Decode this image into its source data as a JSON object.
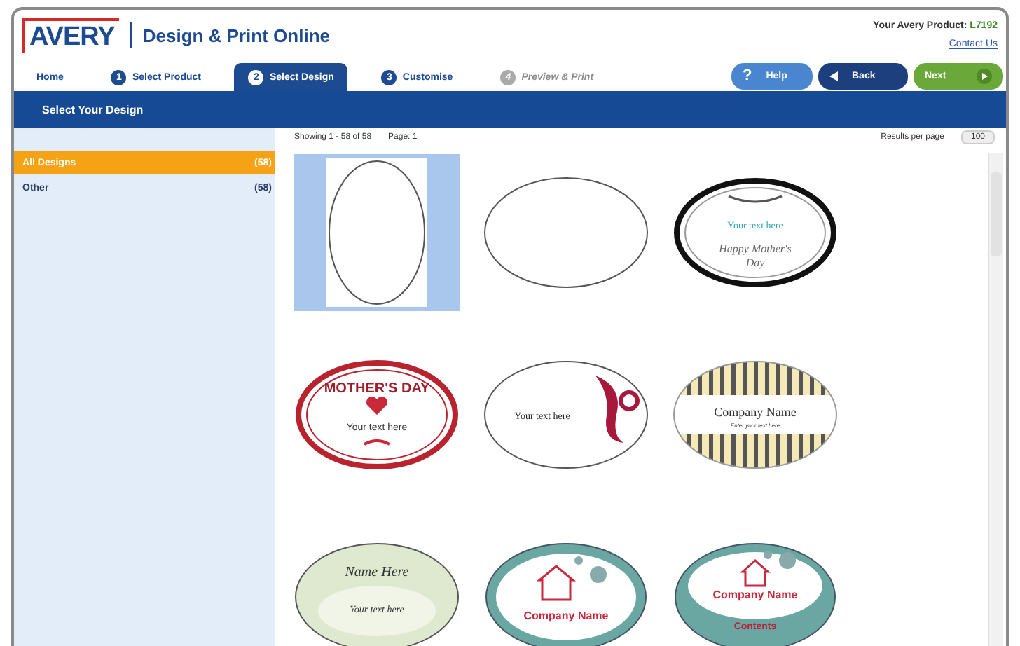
{
  "header": {
    "logo": "AVERY",
    "title": "Design & Print Online",
    "product_label": "Your Avery Product:",
    "product_code": "L7192",
    "contact_link": "Contact Us"
  },
  "steps": [
    {
      "label": "Home",
      "selected": false,
      "disabled": false
    },
    {
      "number": "1",
      "label": "Select Product",
      "selected": false,
      "disabled": false
    },
    {
      "number": "2",
      "label": "Select Design",
      "selected": true,
      "disabled": false
    },
    {
      "number": "3",
      "label": "Customise",
      "selected": false,
      "disabled": false
    },
    {
      "number": "4",
      "label": "Preview & Print",
      "selected": false,
      "disabled": true
    }
  ],
  "nav_buttons": [
    {
      "kind": "help",
      "icon": "?",
      "label": "Help"
    },
    {
      "kind": "back",
      "label": "Back"
    },
    {
      "kind": "next",
      "label": "Next"
    }
  ],
  "page_title": "Select Your Design",
  "sidebar": {
    "items": [
      {
        "label": "All Designs",
        "count": "(58)",
        "selected": true
      },
      {
        "label": "Other",
        "count": "(58)",
        "selected": false
      }
    ]
  },
  "results": {
    "showing": "Showing 1 - 58 of 58",
    "page": "Page:  1",
    "per_page_label": "Results per page",
    "per_page": "100"
  },
  "designs": [
    {
      "kind": "blank-portrait",
      "selected": true
    },
    {
      "kind": "blank",
      "selected": false
    },
    {
      "kind": "frame",
      "selected": false,
      "texts": [
        "Your text here",
        "Happy Mother's",
        "Day"
      ]
    },
    {
      "kind": "stamp",
      "selected": false,
      "texts": [
        "MOTHER'S DAY",
        "Your text here"
      ]
    },
    {
      "kind": "floral",
      "selected": false,
      "texts": [
        "Your text here"
      ]
    },
    {
      "kind": "stripes",
      "selected": false,
      "texts": [
        "Company Name",
        "Enter your text here"
      ]
    },
    {
      "kind": "green",
      "selected": false,
      "texts": [
        "Name Here",
        "Your text here"
      ]
    },
    {
      "kind": "house",
      "selected": false,
      "texts": [
        "Company Name"
      ]
    },
    {
      "kind": "house-contents",
      "selected": false,
      "texts": [
        "Company Name",
        "Contents"
      ]
    }
  ]
}
